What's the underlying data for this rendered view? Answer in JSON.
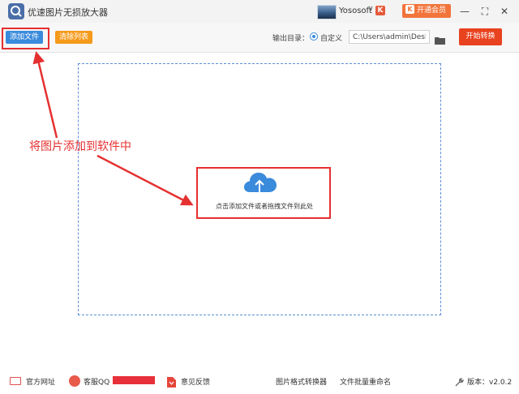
{
  "titlebar": {
    "app_title": "优速图片无损放大器",
    "user_name": "Yososoft",
    "user_chevron": "∨",
    "vip_flag": "K",
    "vip_button_label": "开通会员",
    "min_icon": "—",
    "max_icon": "⛶",
    "close_icon": "✕"
  },
  "toolbar": {
    "add_file_label": "添加文件",
    "clear_list_label": "清除列表",
    "output_dir_label": "输出目录：",
    "custom_label": "自定义",
    "output_path": "C:\\Users\\admin\\Deskto",
    "start_convert_label": "开始转换"
  },
  "drop_area": {
    "hint": "点击添加文件或者拖拽文件到此处"
  },
  "annotation": {
    "text": "将图片添加到软件中"
  },
  "footer": {
    "website_label": "官方网址",
    "support_label": "客服QQ",
    "feedback_label": "意见反馈",
    "format_converter_label": "图片格式转换器",
    "batch_rename_label": "文件批量重命名",
    "version_label": "版本：v2.0.2"
  },
  "colors": {
    "accent_blue": "#3a8bdc",
    "accent_orange": "#f59a1b",
    "primary_red": "#e8421f",
    "annotation_red": "#e53030"
  }
}
